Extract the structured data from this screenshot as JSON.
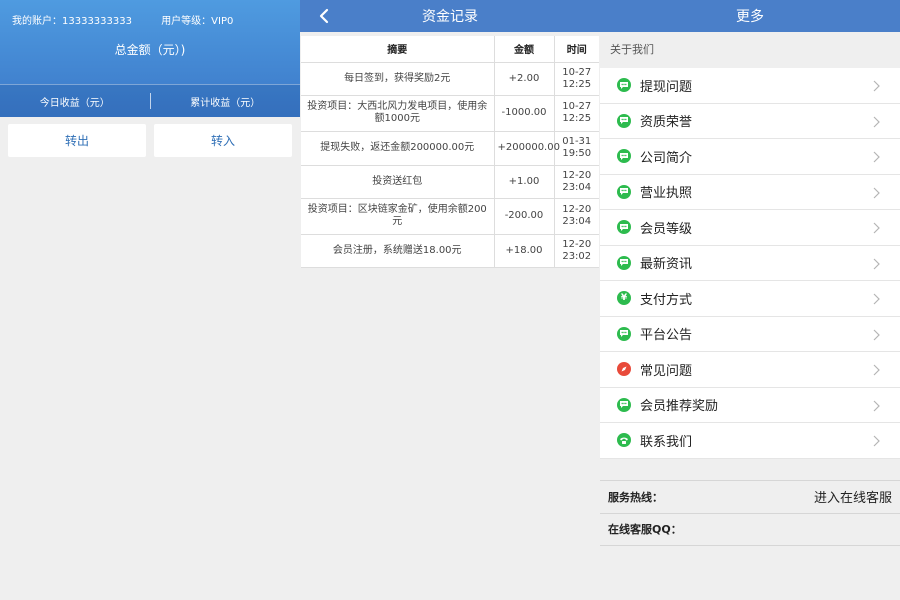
{
  "account": {
    "account_label": "我的账户：13333333333",
    "level_label": "用户等级：VIP0",
    "total_label": "总金额（元）)",
    "today_label": "今日收益（元）",
    "cumulative_label": "累计收益（元）",
    "withdraw_label": "转出",
    "deposit_label": "转入"
  },
  "records": {
    "title": "资金记录",
    "headers": {
      "summary": "摘要",
      "amount": "金额",
      "time": "时间"
    },
    "rows": [
      {
        "summary": "每日签到，获得奖励2元",
        "amount": "+2.00",
        "date": "10-27",
        "time": "12:25"
      },
      {
        "summary": "投资项目：大西北风力发电项目，使用余额1000元",
        "amount": "-1000.00",
        "date": "10-27",
        "time": "12:25"
      },
      {
        "summary": "提现失败，返还金额200000.00元",
        "amount": "+200000.00",
        "date": "01-31",
        "time": "19:50"
      },
      {
        "summary": "投资送红包",
        "amount": "+1.00",
        "date": "12-20",
        "time": "23:04"
      },
      {
        "summary": "投资项目：区块链家金矿，使用余额200元",
        "amount": "-200.00",
        "date": "12-20",
        "time": "23:04"
      },
      {
        "summary": "会员注册，系统赠送18.00元",
        "amount": "+18.00",
        "date": "12-20",
        "time": "23:02"
      }
    ]
  },
  "more": {
    "title": "更多",
    "section_label": "关于我们",
    "items": [
      {
        "label": "提现问题",
        "icon": "chat-bubble-icon",
        "color": "#2dbb4e"
      },
      {
        "label": "资质荣誉",
        "icon": "chat-bubble-icon",
        "color": "#2dbb4e"
      },
      {
        "label": "公司简介",
        "icon": "chat-bubble-icon",
        "color": "#2dbb4e"
      },
      {
        "label": "营业执照",
        "icon": "chat-bubble-icon",
        "color": "#2dbb4e"
      },
      {
        "label": "会员等级",
        "icon": "chat-bubble-icon",
        "color": "#2dbb4e"
      },
      {
        "label": "最新资讯",
        "icon": "chat-bubble-icon",
        "color": "#2dbb4e"
      },
      {
        "label": "支付方式",
        "icon": "yen-icon",
        "color": "#2dbb4e"
      },
      {
        "label": "平台公告",
        "icon": "chat-bubble-icon",
        "color": "#2dbb4e"
      },
      {
        "label": "常见问题",
        "icon": "compass-icon",
        "color": "#e84a3a"
      },
      {
        "label": "会员推荐奖励",
        "icon": "chat-bubble-icon",
        "color": "#2dbb4e"
      },
      {
        "label": "联系我们",
        "icon": "phone-icon",
        "color": "#2dbb4e"
      }
    ],
    "hotline_label": "服务热线：",
    "online_service_link": "进入在线客服",
    "qq_label": "在线客服QQ："
  },
  "colors": {
    "header_blue": "#4a7fc9",
    "positive": "#1a8f1a",
    "negative": "#e5001b"
  }
}
